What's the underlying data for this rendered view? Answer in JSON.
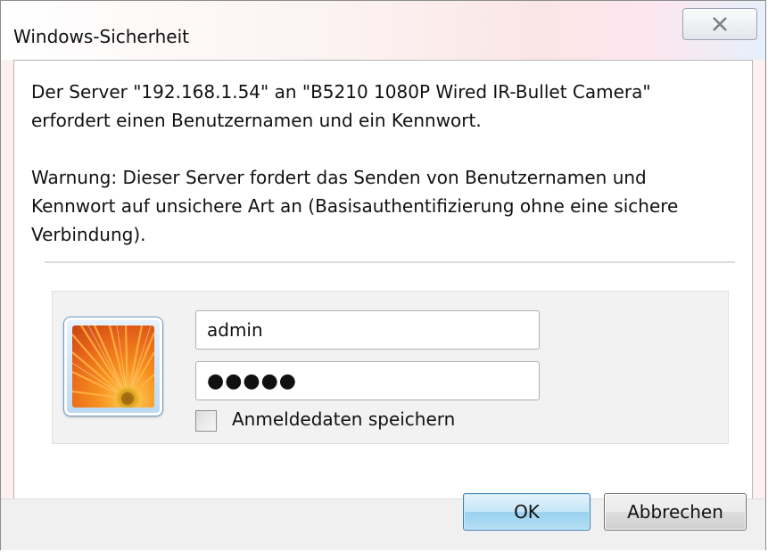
{
  "window": {
    "title": "Windows-Sicherheit",
    "close_label": "Schließen"
  },
  "message": {
    "line1": "Der Server \"192.168.1.54\" an \"B5210 1080P Wired IR-Bullet Camera\" erfordert einen Benutzernamen und ein Kennwort.",
    "warning": "Warnung: Dieser Server fordert das Senden von Benutzernamen und Kennwort auf unsichere Art an (Basisauthentifizierung ohne eine sichere Verbindung)."
  },
  "credentials": {
    "username_value": "admin",
    "password_masked": "●●●●●",
    "remember_label": "Anmeldedaten speichern",
    "remember_checked": false,
    "avatar_icon": "user-tile-flower-icon"
  },
  "buttons": {
    "ok_label": "OK",
    "cancel_label": "Abbrechen"
  },
  "colors": {
    "accent_button": "#98d1ef",
    "avatar_orange": "#f07a18"
  }
}
